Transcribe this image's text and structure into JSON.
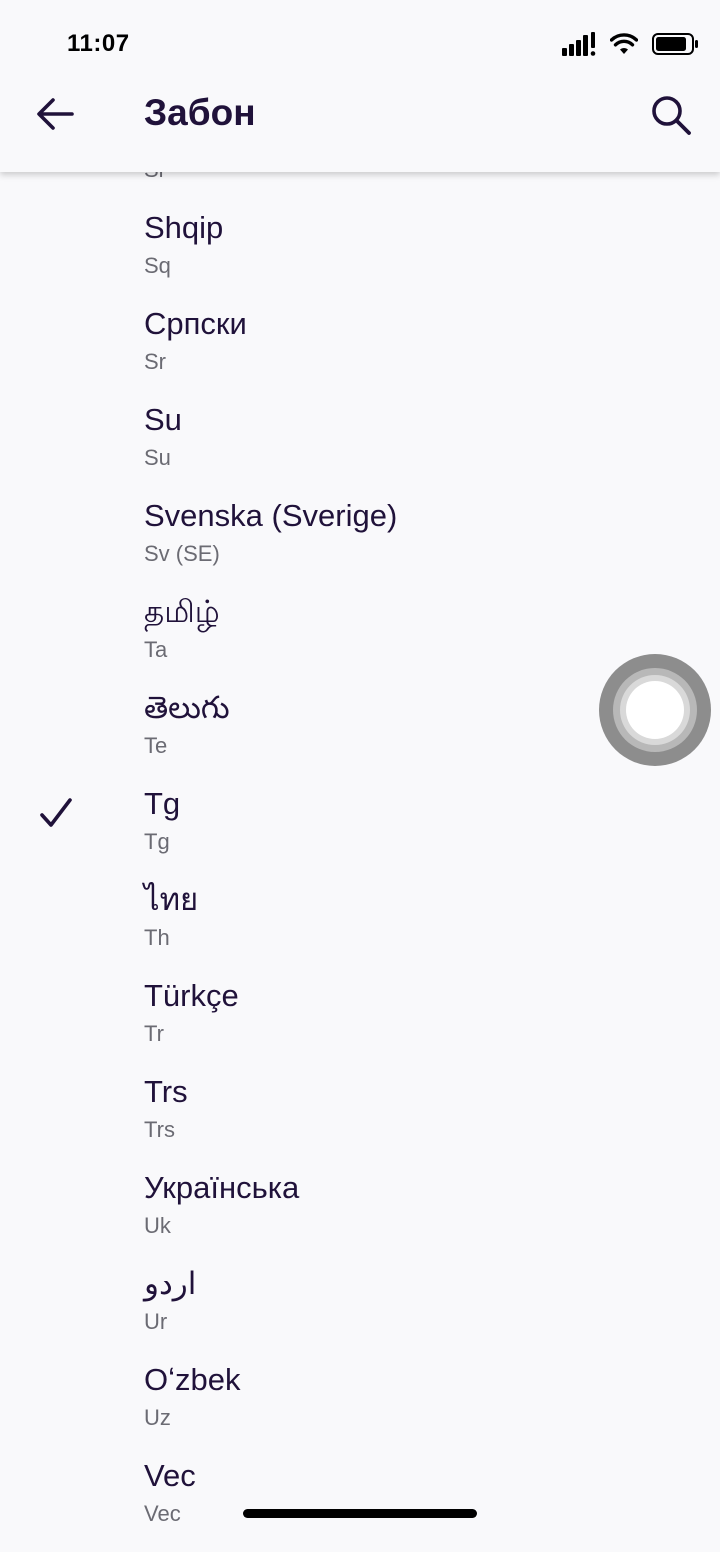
{
  "status_bar": {
    "time": "11:07",
    "icons": [
      "cellular-signal-icon",
      "wifi-icon",
      "battery-icon"
    ]
  },
  "app_bar": {
    "title": "Забон",
    "back_icon": "arrow-left-icon",
    "search_icon": "search-icon"
  },
  "languages": {
    "partial_top": {
      "code": "Sl"
    },
    "items": [
      {
        "name": "Shqip",
        "code": "Sq",
        "selected": false
      },
      {
        "name": "Српски",
        "code": "Sr",
        "selected": false
      },
      {
        "name": "Su",
        "code": "Su",
        "selected": false
      },
      {
        "name": "Svenska (Sverige)",
        "code": "Sv (SE)",
        "selected": false
      },
      {
        "name": "தமிழ்",
        "code": "Ta",
        "selected": false
      },
      {
        "name": "తెలుగు",
        "code": "Te",
        "selected": false
      },
      {
        "name": "Tg",
        "code": "Tg",
        "selected": true
      },
      {
        "name": "ไทย",
        "code": "Th",
        "selected": false
      },
      {
        "name": "Türkçe",
        "code": "Tr",
        "selected": false
      },
      {
        "name": "Trs",
        "code": "Trs",
        "selected": false
      },
      {
        "name": "Українська",
        "code": "Uk",
        "selected": false
      },
      {
        "name": "اردو",
        "code": "Ur",
        "selected": false
      },
      {
        "name": "Oʻzbek",
        "code": "Uz",
        "selected": false
      },
      {
        "name": "Vec",
        "code": "Vec",
        "selected": false
      }
    ]
  },
  "colors": {
    "background": "#f9f9fb",
    "primary_text": "#20123a",
    "secondary_text": "#6b6b73"
  }
}
